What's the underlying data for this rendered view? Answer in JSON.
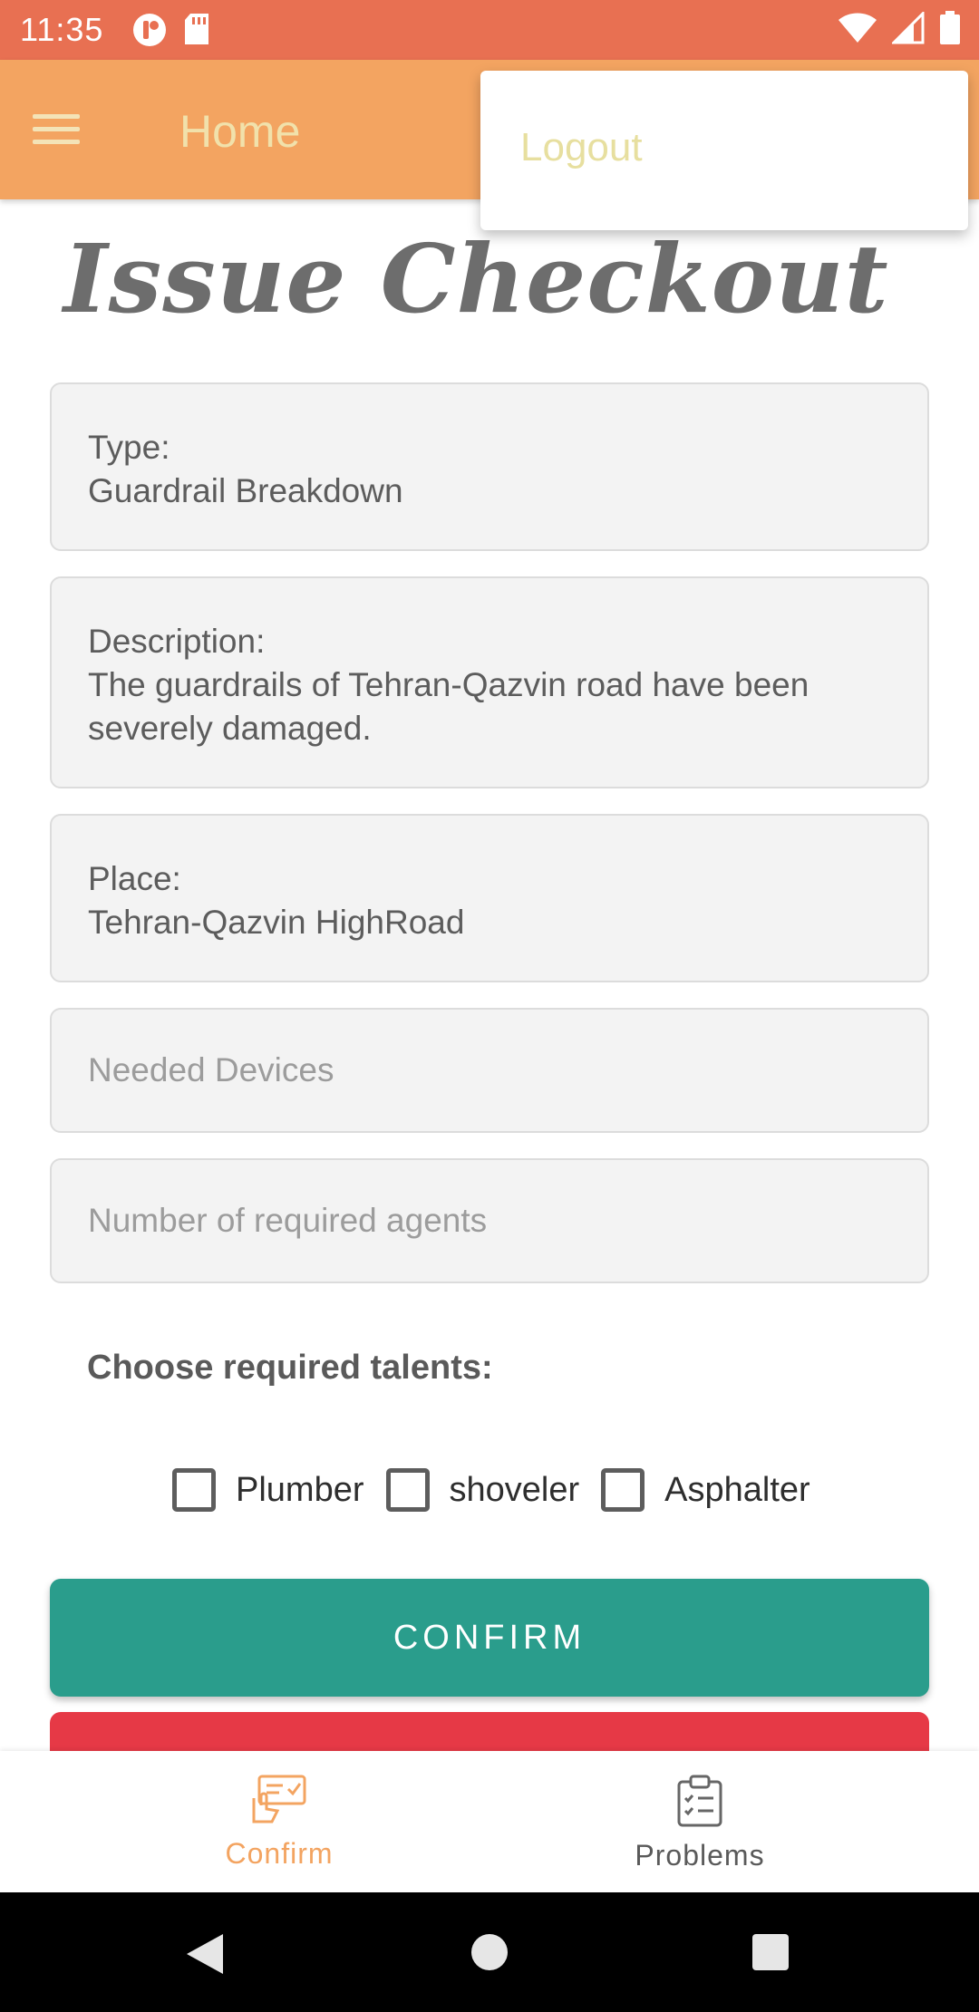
{
  "status_bar": {
    "time": "11:35",
    "left_icons": [
      "notification-app-icon",
      "sd-card-icon"
    ],
    "right_icons": [
      "wifi-icon",
      "signal-icon",
      "battery-icon"
    ]
  },
  "app_bar": {
    "title": "Home",
    "menu_icon": "hamburger-menu-icon"
  },
  "popup_menu": {
    "items": [
      "Logout"
    ]
  },
  "page": {
    "heading": "Issue Checkout"
  },
  "fields": {
    "type_label": "Type:",
    "type_value": "Guardrail Breakdown",
    "description_label": "Description:",
    "description_value": "The guardrails of Tehran-Qazvin road have been severely damaged.",
    "place_label": "Place:",
    "place_value": "Tehran-Qazvin HighRoad"
  },
  "inputs": {
    "devices_placeholder": "Needed Devices",
    "agents_placeholder": "Number of required agents"
  },
  "talents": {
    "label": "Choose required talents:",
    "options": [
      {
        "label": "Plumber",
        "checked": false
      },
      {
        "label": "shoveler",
        "checked": false
      },
      {
        "label": "Asphalter",
        "checked": false
      }
    ]
  },
  "buttons": {
    "confirm": "CONFIRM"
  },
  "bottom_nav": {
    "items": [
      {
        "label": "Confirm",
        "icon": "confirm-hand-icon",
        "active": true
      },
      {
        "label": "Problems",
        "icon": "clipboard-checklist-icon",
        "active": false
      }
    ]
  },
  "colors": {
    "status_bar": "#e87052",
    "app_bar": "#f3a461",
    "confirm_button": "#2a9d8c",
    "danger_button": "#e63946",
    "active_nav": "#f3a461"
  }
}
